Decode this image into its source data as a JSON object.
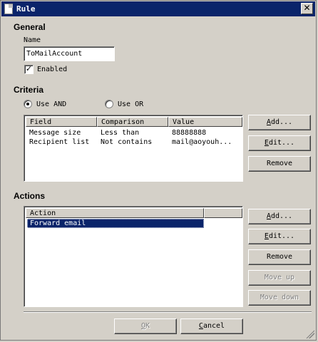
{
  "window": {
    "title": "Rule"
  },
  "general": {
    "heading": "General",
    "name_label": "Name",
    "name_value": "ToMailAccount",
    "enabled_label": "Enabled",
    "enabled_checked": true
  },
  "criteria": {
    "heading": "Criteria",
    "use_and_label": "Use AND",
    "use_or_label": "Use OR",
    "selected_mode": "Use AND",
    "columns": [
      "Field",
      "Comparison",
      "Value"
    ],
    "rows": [
      {
        "field": "Message size",
        "comparison": "Less than",
        "value": "88888888"
      },
      {
        "field": "Recipient list",
        "comparison": "Not contains",
        "value": "mail@aoyouh..."
      }
    ],
    "buttons": {
      "add": "Add...",
      "edit": "Edit...",
      "remove": "Remove"
    }
  },
  "actions": {
    "heading": "Actions",
    "columns": [
      "Action"
    ],
    "rows": [
      {
        "action": "Forward email",
        "selected": true
      }
    ],
    "buttons": {
      "add": "Add...",
      "edit": "Edit...",
      "remove": "Remove",
      "move_up": "Move up",
      "move_down": "Move down"
    }
  },
  "footer": {
    "ok": "OK",
    "cancel": "Cancel"
  }
}
